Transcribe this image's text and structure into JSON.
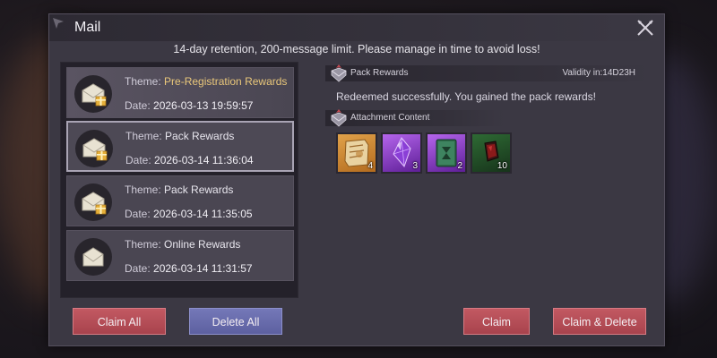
{
  "window": {
    "title": "Mail",
    "notice": "14-day retention, 200-message limit. Please manage in time to avoid loss!"
  },
  "mails": [
    {
      "theme_label": "Theme:",
      "theme": "Pre-Registration Rewards",
      "date_label": "Date:",
      "date": "2026-03-13 19:59:57",
      "has_gift": true
    },
    {
      "theme_label": "Theme:",
      "theme": "Pack Rewards",
      "date_label": "Date:",
      "date": "2026-03-14 11:36:04",
      "has_gift": true,
      "selected": true
    },
    {
      "theme_label": "Theme:",
      "theme": "Pack Rewards",
      "date_label": "Date:",
      "date": "2026-03-14 11:35:05",
      "has_gift": true
    },
    {
      "theme_label": "Theme:",
      "theme": "Online Rewards",
      "date_label": "Date:",
      "date": "2026-03-14 11:31:57",
      "has_gift": false
    }
  ],
  "detail": {
    "header_label": "Pack Rewards",
    "validity": "Validity in:14D23H",
    "message": "Redeemed successfully. You gained the pack rewards!",
    "attachment_label": "Attachment Content",
    "items": [
      {
        "icon": "scroll-map-icon",
        "count": "4",
        "rarity_color": "#d9962f"
      },
      {
        "icon": "purple-crystal-icon",
        "count": "3",
        "rarity_color": "#a54be0"
      },
      {
        "icon": "green-tome-icon",
        "count": "2",
        "rarity_color": "#a54be0"
      },
      {
        "icon": "red-gem-icon",
        "count": "10",
        "rarity_color": "#2f6b35"
      }
    ]
  },
  "buttons": {
    "claim_all": "Claim All",
    "delete_all": "Delete All",
    "claim": "Claim",
    "claim_delete": "Claim & Delete"
  },
  "colors": {
    "accent_gold": "#e9c77a",
    "button_red": "#b84c55",
    "button_blue": "#6a6dae"
  }
}
